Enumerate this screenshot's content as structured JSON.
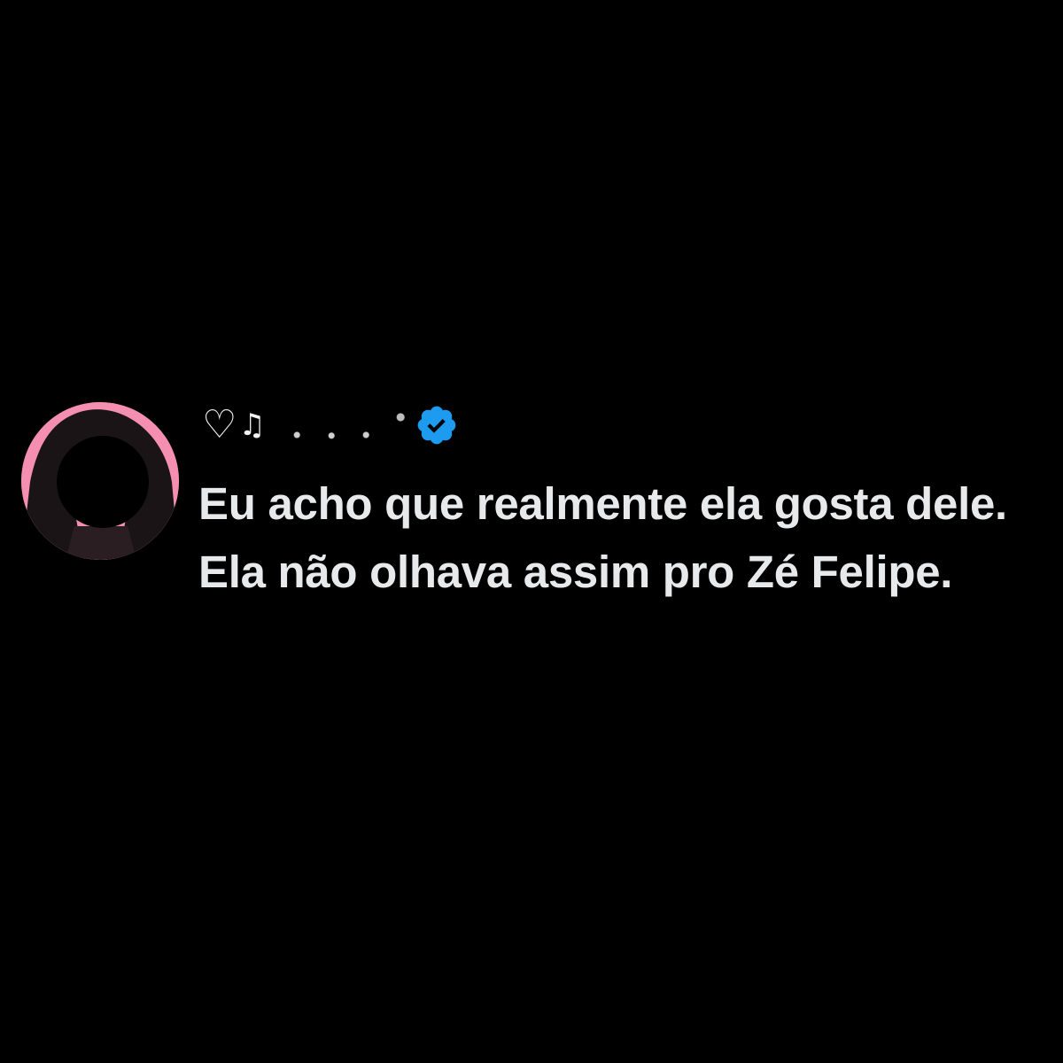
{
  "post": {
    "author": {
      "display_name_prefix": "♡",
      "display_name_glyph": "♫",
      "display_name_redacted": true,
      "verified_icon": "verified-badge-icon",
      "verified_color": "#1d9bf0",
      "avatar_background": "#f48fb1"
    },
    "text": "Eu acho que realmente ela gosta dele. Ela não olhava assim pro Zé Felipe."
  },
  "colors": {
    "background": "#000000",
    "text": "#e7e9ea"
  }
}
